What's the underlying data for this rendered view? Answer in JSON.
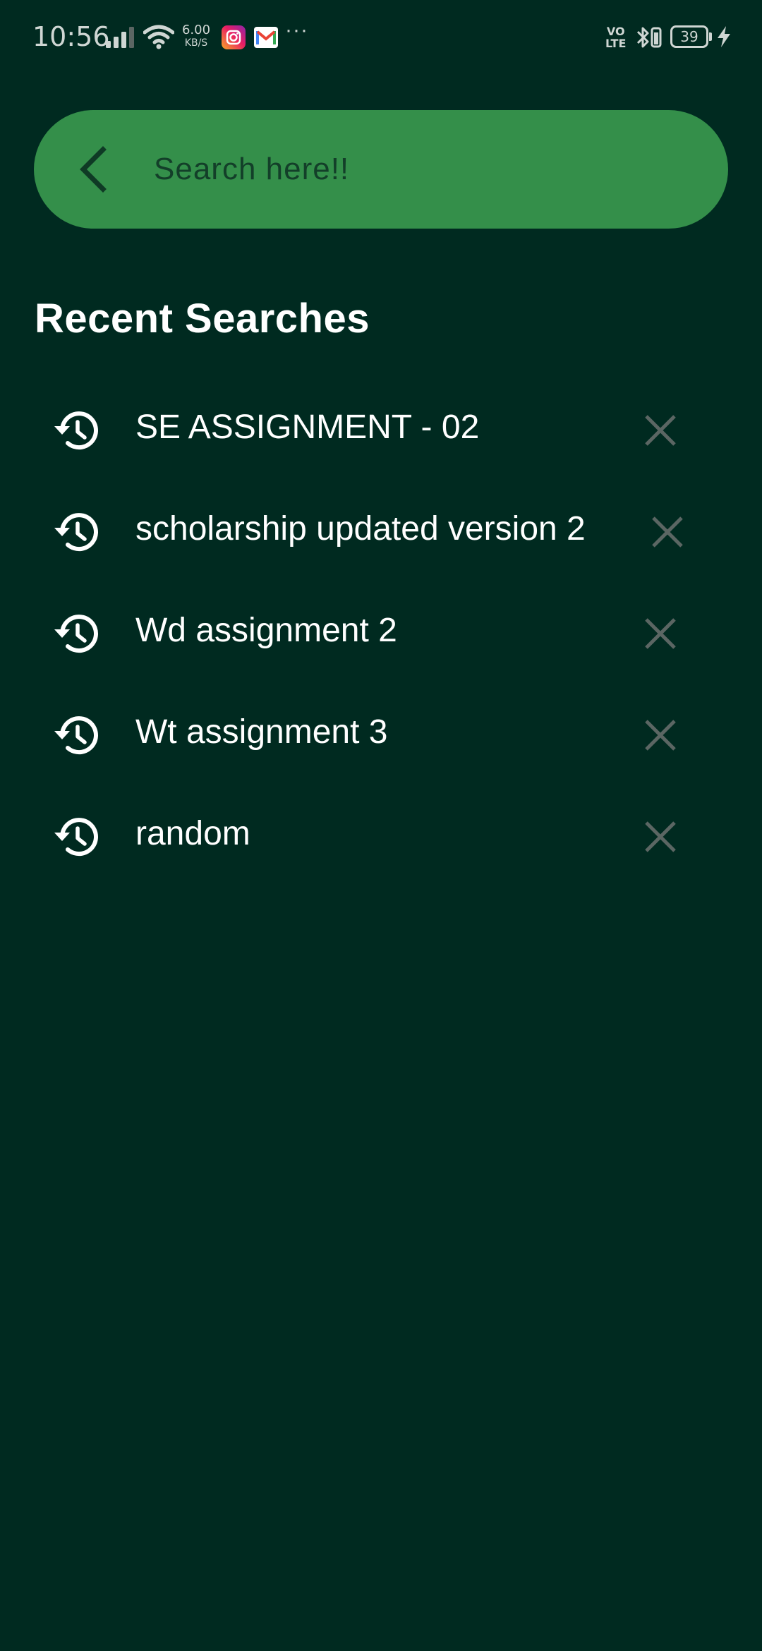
{
  "status_bar": {
    "time": "10:56",
    "net_speed_value": "6.00",
    "net_speed_unit": "KB/S",
    "more": "···",
    "volte_top": "VO",
    "volte_bottom": "LTE",
    "battery": "39"
  },
  "search": {
    "placeholder": "Search here!!",
    "value": "",
    "back_icon": "chevron-left-icon"
  },
  "recent": {
    "title": "Recent Searches",
    "items": [
      {
        "label": "SE ASSIGNMENT - 02",
        "icon": "history-icon",
        "remove_icon": "close-icon"
      },
      {
        "label": "scholarship updated version 2",
        "icon": "history-icon",
        "remove_icon": "close-icon"
      },
      {
        "label": "Wd assignment 2",
        "icon": "history-icon",
        "remove_icon": "close-icon"
      },
      {
        "label": "Wt assignment 3",
        "icon": "history-icon",
        "remove_icon": "close-icon"
      },
      {
        "label": "random",
        "icon": "history-icon",
        "remove_icon": "close-icon"
      }
    ]
  },
  "colors": {
    "background": "#002a20",
    "search_bar": "#348f4a",
    "search_text": "#133f29",
    "close_icon": "#5b6663",
    "text": "#ffffff"
  }
}
